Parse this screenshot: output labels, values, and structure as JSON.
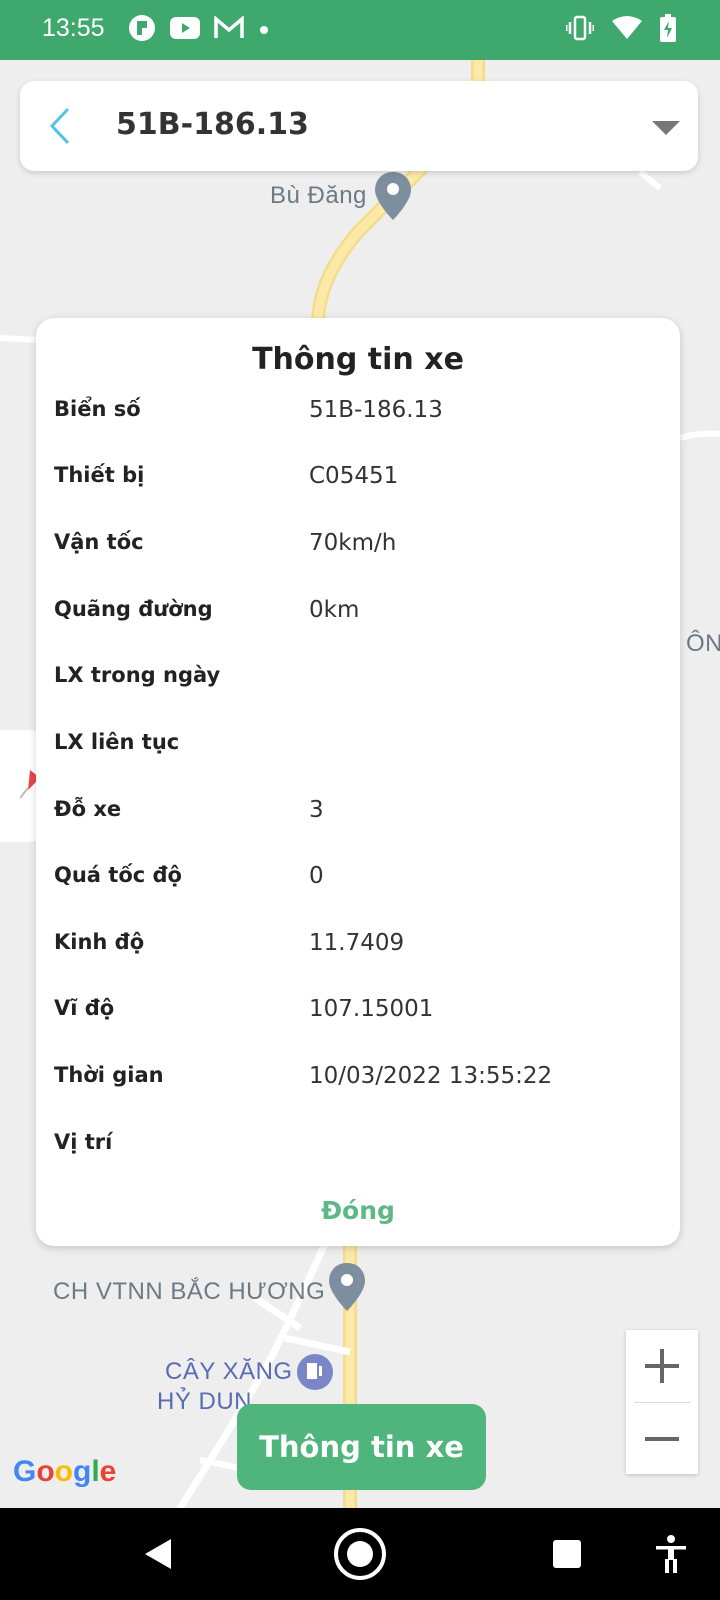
{
  "status_bar": {
    "time": "13:55",
    "left_icons": [
      "app-icon",
      "youtube-icon",
      "gmail-icon",
      "dot-icon"
    ],
    "right_icons": [
      "vibrate-icon",
      "wifi-icon",
      "battery-charging-icon"
    ]
  },
  "top_bar": {
    "title": "51B-186.13"
  },
  "map": {
    "labels": {
      "place_top": "Bù Đăng",
      "place_right": "ÔNG",
      "place_station": "CH VTNN BẮC HƯƠNG",
      "place_gas_1": "CÂY XĂNG",
      "place_gas_2": "HỶ DUN"
    },
    "google_letters": [
      "G",
      "o",
      "o",
      "g",
      "l",
      "e"
    ],
    "google_colors": [
      "#4285F4",
      "#EA4335",
      "#FBBC05",
      "#4285F4",
      "#34A853",
      "#EA4335"
    ]
  },
  "card": {
    "title": "Thông tin xe",
    "rows": [
      {
        "label": "Biển số",
        "value": "51B-186.13"
      },
      {
        "label": "Thiết bị",
        "value": "C05451"
      },
      {
        "label": "Vận tốc",
        "value": "70km/h"
      },
      {
        "label": "Quãng đường",
        "value": "0km"
      },
      {
        "label": "LX trong ngày",
        "value": ""
      },
      {
        "label": "LX liên tục",
        "value": ""
      },
      {
        "label": "Đỗ xe",
        "value": "3"
      },
      {
        "label": "Quá tốc độ",
        "value": "0"
      },
      {
        "label": "Kinh độ",
        "value": "11.7409"
      },
      {
        "label": "Vĩ độ",
        "value": "107.15001"
      },
      {
        "label": "Thời gian",
        "value": "10/03/2022 13:55:22"
      },
      {
        "label": "Vị trí",
        "value": ""
      }
    ],
    "close_label": "Đóng"
  },
  "bottom_button": {
    "label": "Thông tin xe"
  },
  "colors": {
    "status_bar": "#3fa86c",
    "accent": "#4fb57c",
    "close_text": "#5cb985",
    "back_arrow": "#4fc3e8"
  }
}
